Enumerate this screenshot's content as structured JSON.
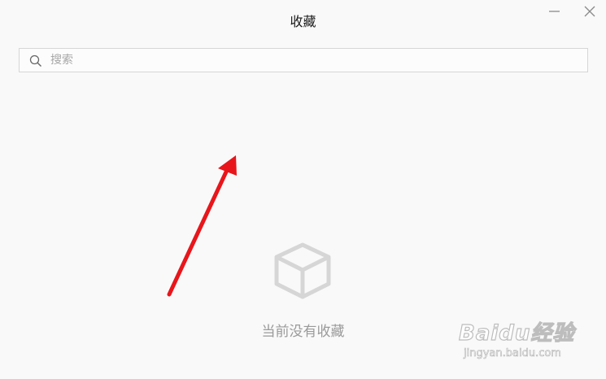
{
  "window": {
    "title": "收藏",
    "minimize_icon": "minimize-icon",
    "close_icon": "close-icon"
  },
  "search": {
    "placeholder": "搜索",
    "value": "",
    "icon": "search-icon"
  },
  "empty_state": {
    "icon": "box-icon",
    "message": "当前没有收藏"
  },
  "annotation": {
    "arrow_color": "#e8161b"
  },
  "watermark": {
    "brand": "Baidu经验",
    "url": "jingyan.baidu.com"
  }
}
